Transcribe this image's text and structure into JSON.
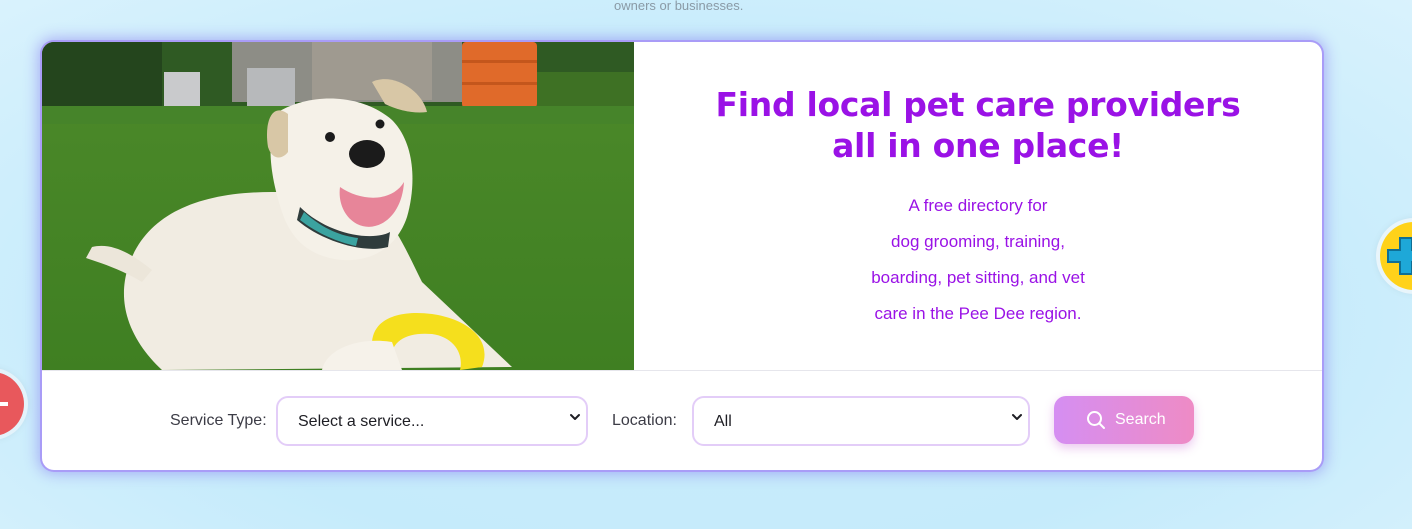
{
  "top_note": "owners or businesses.",
  "hero": {
    "image_alt": "White dog lying on grass with a yellow ring toy",
    "headline_line1": "Find local pet care providers",
    "headline_line2": "all in one place!",
    "description_lines": [
      "A free directory for",
      "dog grooming, training,",
      "boarding, pet sitting, and vet",
      "care in the Pee Dee region."
    ]
  },
  "search": {
    "service_label": "Service Type:",
    "service_selected": "Select a service...",
    "location_label": "Location:",
    "location_selected": "All",
    "button_label": "Search"
  },
  "colors": {
    "brand_purple": "#9a12e6",
    "button_gradient_start": "#d58ef2",
    "button_gradient_end": "#ee8bc5",
    "select_border": "#e3cdf8",
    "fab_left": "#e8585c",
    "fab_right": "#ffd21a"
  },
  "icons": {
    "search": "magnifier-icon",
    "select_chevron": "chevron-down-icon",
    "fab_left": "minus-icon",
    "fab_right": "plus-icon"
  }
}
